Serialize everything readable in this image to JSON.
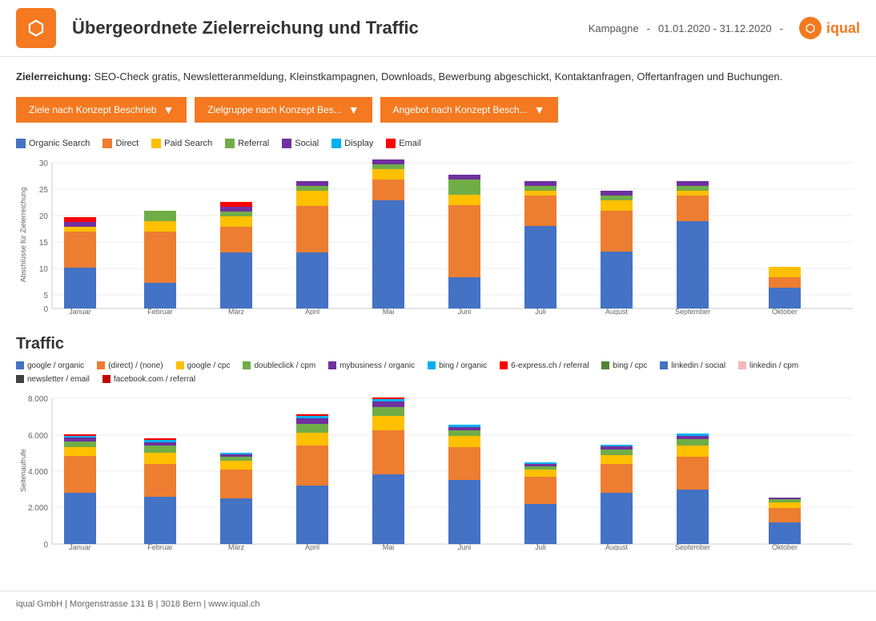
{
  "header": {
    "title": "Übergeordnete Zielerreichung und Traffic",
    "campaign_label": "Kampagne",
    "date_range": "01.01.2020 - 31.12.2020",
    "logo_text": "iqual"
  },
  "zielerreichung": {
    "label": "Zielerreichung:",
    "text": "SEO-Check gratis, Newsletteranmeldung, Kleinstkampagnen, Downloads, Bewerbung abgeschickt, Kontaktanfragen, Offertanfragen und Buchungen."
  },
  "filters": [
    {
      "id": "filter1",
      "label": "Ziele nach Konzept Beschrieb"
    },
    {
      "id": "filter2",
      "label": "Zielgruppe nach Konzept Bes..."
    },
    {
      "id": "filter3",
      "label": "Angebot nach Konzept Besch..."
    }
  ],
  "abschluesse_chart": {
    "title": "Abschlüsse für Zielerreichung",
    "y_axis_label": "Abschlüsse für Zielerreichung",
    "y_max": 30,
    "y_ticks": [
      0,
      5,
      10,
      15,
      20,
      25,
      30
    ],
    "legend": [
      {
        "key": "organic_search",
        "label": "Organic Search",
        "color": "#4472c4"
      },
      {
        "key": "direct",
        "label": "Direct",
        "color": "#ed7d31"
      },
      {
        "key": "paid_search",
        "label": "Paid Search",
        "color": "#ffc000"
      },
      {
        "key": "referral",
        "label": "Referral",
        "color": "#70ad47"
      },
      {
        "key": "social",
        "label": "Social",
        "color": "#7030a0"
      },
      {
        "key": "display",
        "label": "Display",
        "color": "#00b0f0"
      },
      {
        "key": "email",
        "label": "Email",
        "color": "#ff0000"
      }
    ],
    "months": [
      "Januar",
      "Februar",
      "März",
      "April",
      "Mai",
      "Juni",
      "Juli",
      "August",
      "September",
      "Oktober"
    ],
    "data": [
      {
        "month": "Januar",
        "organic_search": 8,
        "direct": 7,
        "paid_search": 1,
        "referral": 0,
        "social": 1,
        "display": 0,
        "email": 1
      },
      {
        "month": "Februar",
        "organic_search": 5,
        "direct": 10,
        "paid_search": 2,
        "referral": 2,
        "social": 0,
        "display": 0,
        "email": 0
      },
      {
        "month": "März",
        "organic_search": 11,
        "direct": 5,
        "paid_search": 2,
        "referral": 1,
        "social": 1,
        "display": 0,
        "email": 1
      },
      {
        "month": "April",
        "organic_search": 11,
        "direct": 9,
        "paid_search": 3,
        "referral": 1,
        "social": 1,
        "display": 0,
        "email": 0
      },
      {
        "month": "Mai",
        "organic_search": 21,
        "direct": 4,
        "paid_search": 2,
        "referral": 2,
        "social": 1,
        "display": 0,
        "email": 0
      },
      {
        "month": "Juni",
        "organic_search": 6,
        "direct": 14,
        "paid_search": 2,
        "referral": 3,
        "social": 1,
        "display": 0,
        "email": 0
      },
      {
        "month": "Juli",
        "organic_search": 16,
        "direct": 6,
        "paid_search": 1,
        "referral": 1,
        "social": 1,
        "display": 0,
        "email": 0
      },
      {
        "month": "August",
        "organic_search": 11,
        "direct": 8,
        "paid_search": 2,
        "referral": 1,
        "social": 1,
        "display": 0,
        "email": 0
      },
      {
        "month": "September",
        "organic_search": 17,
        "direct": 5,
        "paid_search": 1,
        "referral": 1,
        "social": 1,
        "display": 0,
        "email": 0
      },
      {
        "month": "Oktober",
        "organic_search": 4,
        "direct": 2,
        "paid_search": 2,
        "referral": 0,
        "social": 0,
        "display": 0,
        "email": 0
      }
    ]
  },
  "traffic_chart": {
    "title": "Traffic",
    "y_axis_label": "Seitenaufrufe",
    "y_max": 8000,
    "y_ticks": [
      0,
      2000,
      4000,
      6000,
      8000
    ],
    "legend": [
      {
        "key": "google_organic",
        "label": "google / organic",
        "color": "#4472c4"
      },
      {
        "key": "direct_none",
        "label": "(direct) / (none)",
        "color": "#ed7d31"
      },
      {
        "key": "google_cpc",
        "label": "google / cpc",
        "color": "#ffc000"
      },
      {
        "key": "doubleclick_cpm",
        "label": "doubleclick / cpm",
        "color": "#70ad47"
      },
      {
        "key": "mybusiness_organic",
        "label": "mybusiness / organic",
        "color": "#7030a0"
      },
      {
        "key": "bing_organic",
        "label": "bing / organic",
        "color": "#00b0f0"
      },
      {
        "key": "6express_referral",
        "label": "6-express.ch / referral",
        "color": "#ff0000"
      },
      {
        "key": "bing_cpc",
        "label": "bing / cpc",
        "color": "#548235"
      },
      {
        "key": "linkedin_social",
        "label": "linkedin / social",
        "color": "#4472c4"
      },
      {
        "key": "linkedin_cpm",
        "label": "linkedin / cpm",
        "color": "#f4b8b8"
      },
      {
        "key": "newsletter_email",
        "label": "newsletter / email",
        "color": "#404040"
      },
      {
        "key": "facebook_referral",
        "label": "facebook.com / referral",
        "color": "#c00000"
      }
    ],
    "months": [
      "Januar",
      "Februar",
      "März",
      "April",
      "Mai",
      "Juni",
      "Juli",
      "August",
      "September",
      "Oktober"
    ],
    "data": [
      {
        "month": "Januar",
        "google_organic": 2800,
        "direct_none": 2000,
        "google_cpc": 500,
        "doubleclick_cpm": 300,
        "mybusiness_organic": 200,
        "bing_organic": 100,
        "6express_referral": 100,
        "bing_cpc": 50,
        "linkedin_social": 50,
        "linkedin_cpm": 50,
        "newsletter_email": 50,
        "facebook_referral": 50
      },
      {
        "month": "Februar",
        "google_organic": 2600,
        "direct_none": 1800,
        "google_cpc": 600,
        "doubleclick_cpm": 400,
        "mybusiness_organic": 200,
        "bing_organic": 150,
        "6express_referral": 100,
        "bing_cpc": 50,
        "linkedin_social": 50,
        "linkedin_cpm": 50,
        "newsletter_email": 50,
        "facebook_referral": 50
      },
      {
        "month": "März",
        "google_organic": 2500,
        "direct_none": 1600,
        "google_cpc": 500,
        "doubleclick_cpm": 200,
        "mybusiness_organic": 150,
        "bing_organic": 100,
        "6express_referral": 80,
        "bing_cpc": 50,
        "linkedin_social": 50,
        "linkedin_cpm": 50,
        "newsletter_email": 50,
        "facebook_referral": 50
      },
      {
        "month": "April",
        "google_organic": 3200,
        "direct_none": 2200,
        "google_cpc": 700,
        "doubleclick_cpm": 500,
        "mybusiness_organic": 300,
        "bing_organic": 200,
        "6express_referral": 150,
        "bing_cpc": 80,
        "linkedin_social": 80,
        "linkedin_cpm": 60,
        "newsletter_email": 60,
        "facebook_referral": 60
      },
      {
        "month": "Mai",
        "google_organic": 3800,
        "direct_none": 2400,
        "google_cpc": 800,
        "doubleclick_cpm": 500,
        "mybusiness_organic": 300,
        "bing_organic": 200,
        "6express_referral": 150,
        "bing_cpc": 100,
        "linkedin_social": 100,
        "linkedin_cpm": 80,
        "newsletter_email": 80,
        "facebook_referral": 80
      },
      {
        "month": "Juni",
        "google_organic": 3500,
        "direct_none": 1800,
        "google_cpc": 600,
        "doubleclick_cpm": 300,
        "mybusiness_organic": 200,
        "bing_organic": 150,
        "6express_referral": 100,
        "bing_cpc": 60,
        "linkedin_social": 60,
        "linkedin_cpm": 50,
        "newsletter_email": 50,
        "facebook_referral": 50
      },
      {
        "month": "Juli",
        "google_organic": 2200,
        "direct_none": 1500,
        "google_cpc": 400,
        "doubleclick_cpm": 200,
        "mybusiness_organic": 150,
        "bing_organic": 100,
        "6express_referral": 80,
        "bing_cpc": 40,
        "linkedin_social": 40,
        "linkedin_cpm": 30,
        "newsletter_email": 30,
        "facebook_referral": 30
      },
      {
        "month": "August",
        "google_organic": 2800,
        "direct_none": 1600,
        "google_cpc": 500,
        "doubleclick_cpm": 300,
        "mybusiness_organic": 200,
        "bing_organic": 120,
        "6express_referral": 100,
        "bing_cpc": 50,
        "linkedin_social": 50,
        "linkedin_cpm": 40,
        "newsletter_email": 40,
        "facebook_referral": 40
      },
      {
        "month": "September",
        "google_organic": 3000,
        "direct_none": 1800,
        "google_cpc": 600,
        "doubleclick_cpm": 350,
        "mybusiness_organic": 250,
        "bing_organic": 150,
        "6express_referral": 120,
        "bing_cpc": 60,
        "linkedin_social": 60,
        "linkedin_cpm": 50,
        "newsletter_email": 50,
        "facebook_referral": 50
      },
      {
        "month": "Oktober",
        "google_organic": 1200,
        "direct_none": 800,
        "google_cpc": 300,
        "doubleclick_cpm": 150,
        "mybusiness_organic": 100,
        "bing_organic": 80,
        "6express_referral": 60,
        "bing_cpc": 30,
        "linkedin_social": 30,
        "linkedin_cpm": 20,
        "newsletter_email": 20,
        "facebook_referral": 20
      }
    ]
  },
  "footer": {
    "text": "iqual GmbH | Morgenstrasse 131 B | 3018 Bern | www.iqual.ch"
  }
}
